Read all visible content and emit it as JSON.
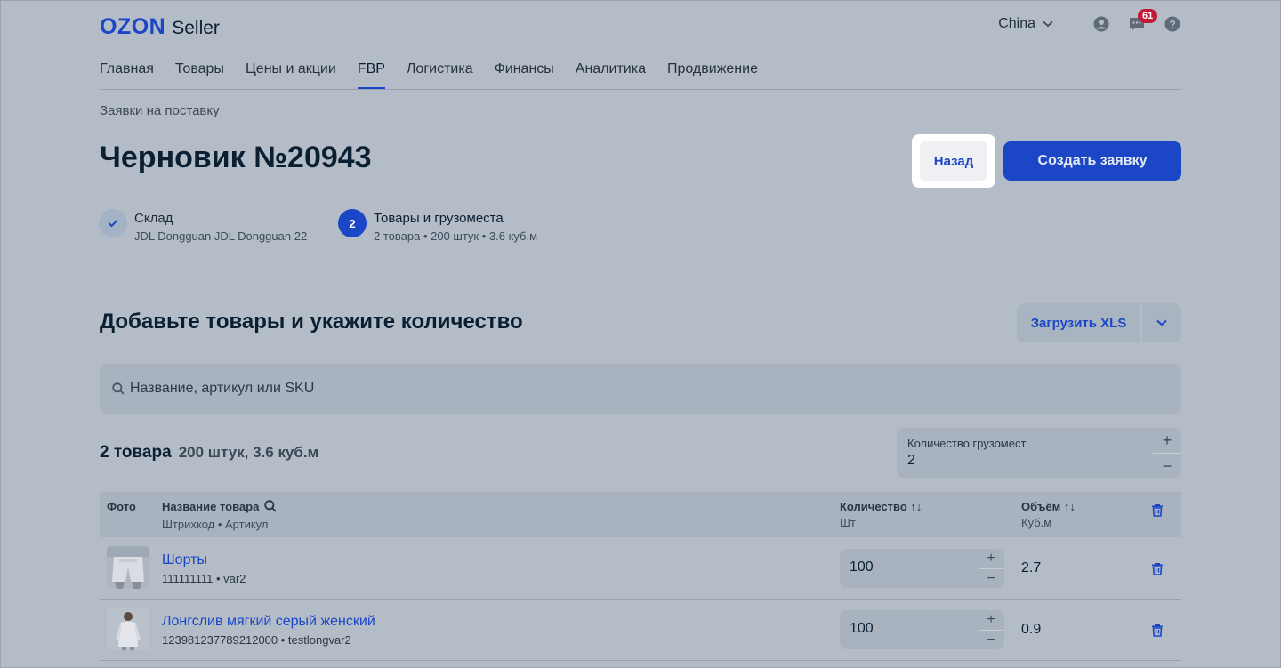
{
  "header": {
    "logo_brand": "OZON",
    "logo_product": "Seller",
    "country": "China",
    "notifications_count": "61"
  },
  "nav": {
    "items": [
      "Главная",
      "Товары",
      "Цены и акции",
      "FBP",
      "Логистика",
      "Финансы",
      "Аналитика",
      "Продвижение"
    ],
    "active": "FBP"
  },
  "breadcrumb": "Заявки на поставку",
  "page": {
    "title": "Черновик №20943",
    "back_label": "Назад",
    "create_label": "Создать заявку"
  },
  "steps": [
    {
      "title": "Склад",
      "subtitle": "JDL Dongguan JDL Dongguan 22",
      "state": "done"
    },
    {
      "number": "2",
      "title": "Товары и грузоместа",
      "subtitle": "2 товара • 200 штук • 3.6 куб.м",
      "state": "current"
    }
  ],
  "section": {
    "title": "Добавьте товары и укажите количество",
    "upload_label": "Загрузить XLS"
  },
  "search": {
    "placeholder": "Название, артикул или SKU"
  },
  "summary": {
    "count": "2 товара",
    "detail": "200 штук, 3.6 куб.м"
  },
  "cargo": {
    "label": "Количество грузомест",
    "value": "2"
  },
  "table": {
    "headers": {
      "photo": "Фото",
      "name": "Название товара",
      "name_sub": "Штрихкод • Артикул",
      "qty": "Количество ↑↓",
      "qty_sub": "Шт",
      "vol": "Объём ↑↓",
      "vol_sub": "Куб.м"
    },
    "rows": [
      {
        "name": "Шорты",
        "sub": "111111111 • var2",
        "qty": "100",
        "vol": "2.7"
      },
      {
        "name": "Лонгслив мягкий серый женский",
        "sub": "123981237789212000 • testlongvar2",
        "qty": "100",
        "vol": "0.9"
      }
    ]
  },
  "colors": {
    "accent": "#1b46c5",
    "badge": "#c2183a",
    "overlay_bg": "#b3bcc7"
  }
}
